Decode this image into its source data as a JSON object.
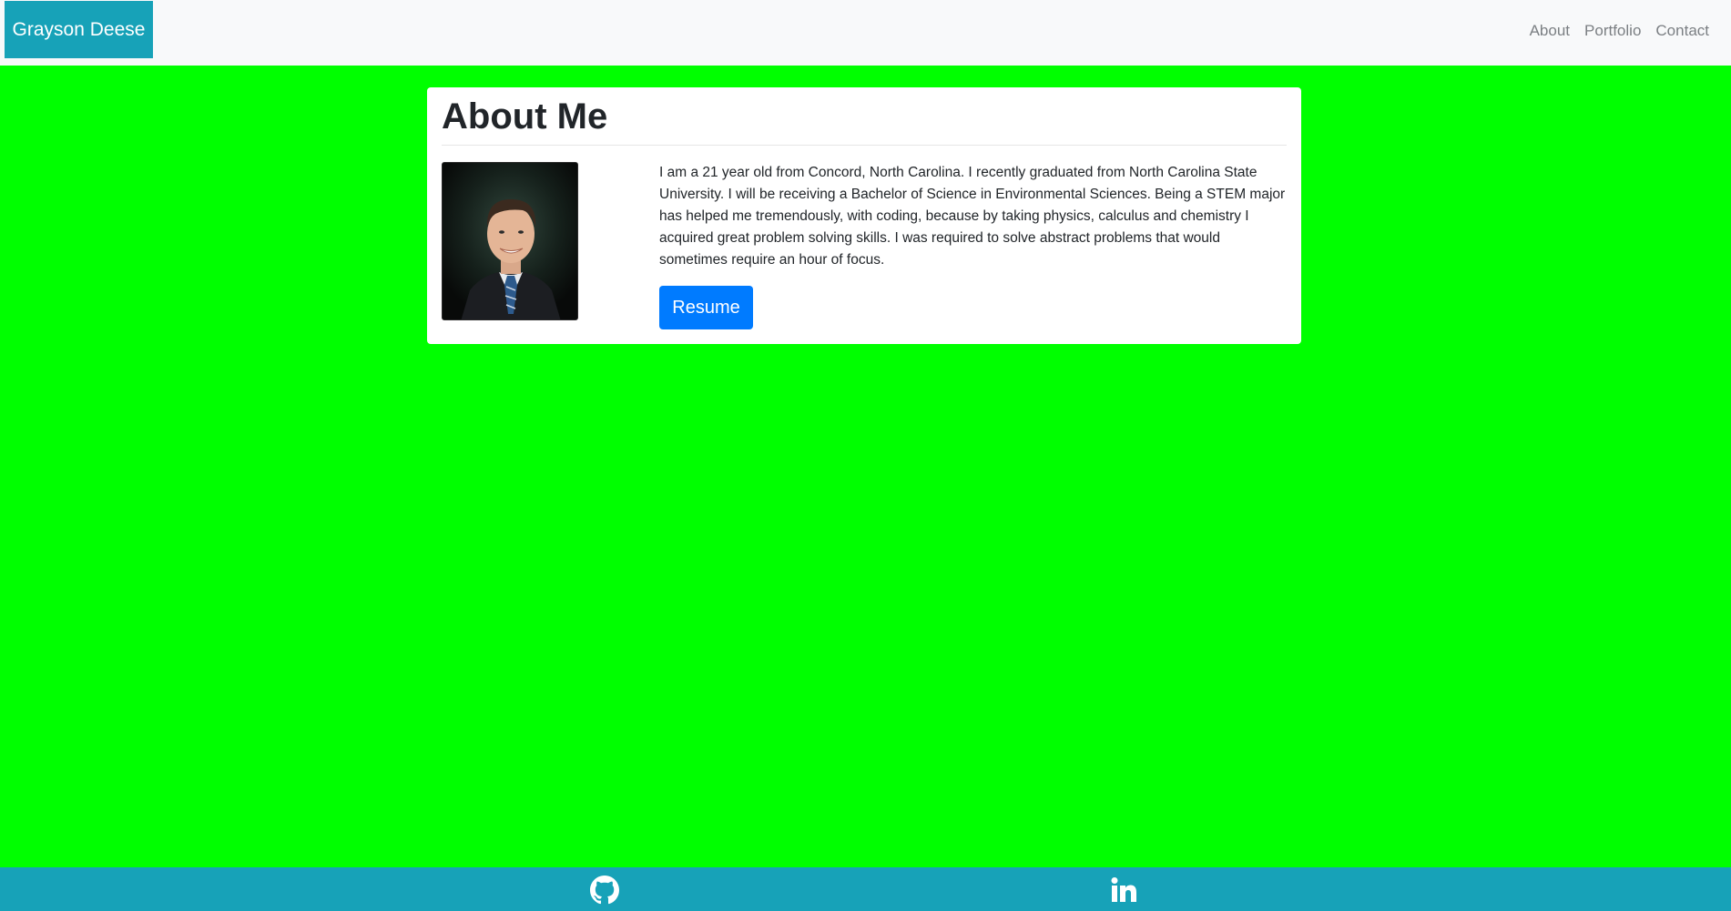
{
  "navbar": {
    "brand": "Grayson Deese",
    "links": [
      {
        "label": "About"
      },
      {
        "label": "Portfolio"
      },
      {
        "label": "Contact"
      }
    ],
    "background": "#f8f9fa",
    "brand_color": "#17a2b8"
  },
  "about": {
    "title": "About Me",
    "bio": "I am a 21 year old from Concord, North Carolina. I recently graduated from North Carolina State University. I will be receiving a Bachelor of Science in Environmental Sciences. Being a STEM major has helped me tremendously, with coding, because by taking physics, calculus and chemistry I acquired great problem solving skills. I was required to solve abstract problems that would sometimes require an hour of focus.",
    "resume_label": "Resume",
    "button_color": "#007bff"
  },
  "page": {
    "background": "#00ff00"
  },
  "footer": {
    "background": "#17a2b8",
    "icons": [
      "github-icon",
      "linkedin-icon"
    ]
  }
}
